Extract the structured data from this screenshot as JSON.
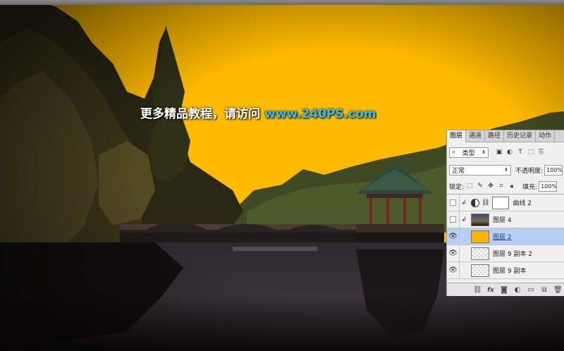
{
  "watermark": {
    "chinese": "更多精品教程，请访问",
    "url": "www.240PS.com"
  },
  "colors": {
    "canvas_background": "#ffbb00",
    "watermark_url": "#36c0f2",
    "selected_layer": "#b6d0f5"
  },
  "layers_panel": {
    "tabs": [
      "图层",
      "通道",
      "路径",
      "历史记录",
      "动作"
    ],
    "filter": {
      "kind_label": "类型",
      "icons": [
        "image-filter-icon",
        "adjustment-filter-icon",
        "type-filter-icon",
        "shape-filter-icon",
        "smart-object-filter-icon"
      ]
    },
    "blend_mode": "正常",
    "opacity_label": "不透明度:",
    "opacity_value": "100%",
    "lock_label": "锁定:",
    "fill_label": "填充:",
    "fill_value": "100%",
    "layers": [
      {
        "name": "曲线 2",
        "type": "adjustment",
        "visible": false,
        "clipped": true
      },
      {
        "name": "图层 4",
        "type": "photo",
        "visible": false,
        "clipped": true
      },
      {
        "name": "图层 2",
        "type": "orange",
        "visible": true,
        "clipped": false,
        "selected": true
      },
      {
        "name": "图层 9 副本 2",
        "type": "checker",
        "visible": true,
        "clipped": false
      },
      {
        "name": "图层 9 副本",
        "type": "checker",
        "visible": true,
        "clipped": false
      }
    ],
    "bottom_icons": [
      "link-icon",
      "fx-icon",
      "mask-icon",
      "adjustment-icon",
      "group-folder-icon",
      "new-layer-icon",
      "trash-icon"
    ]
  }
}
